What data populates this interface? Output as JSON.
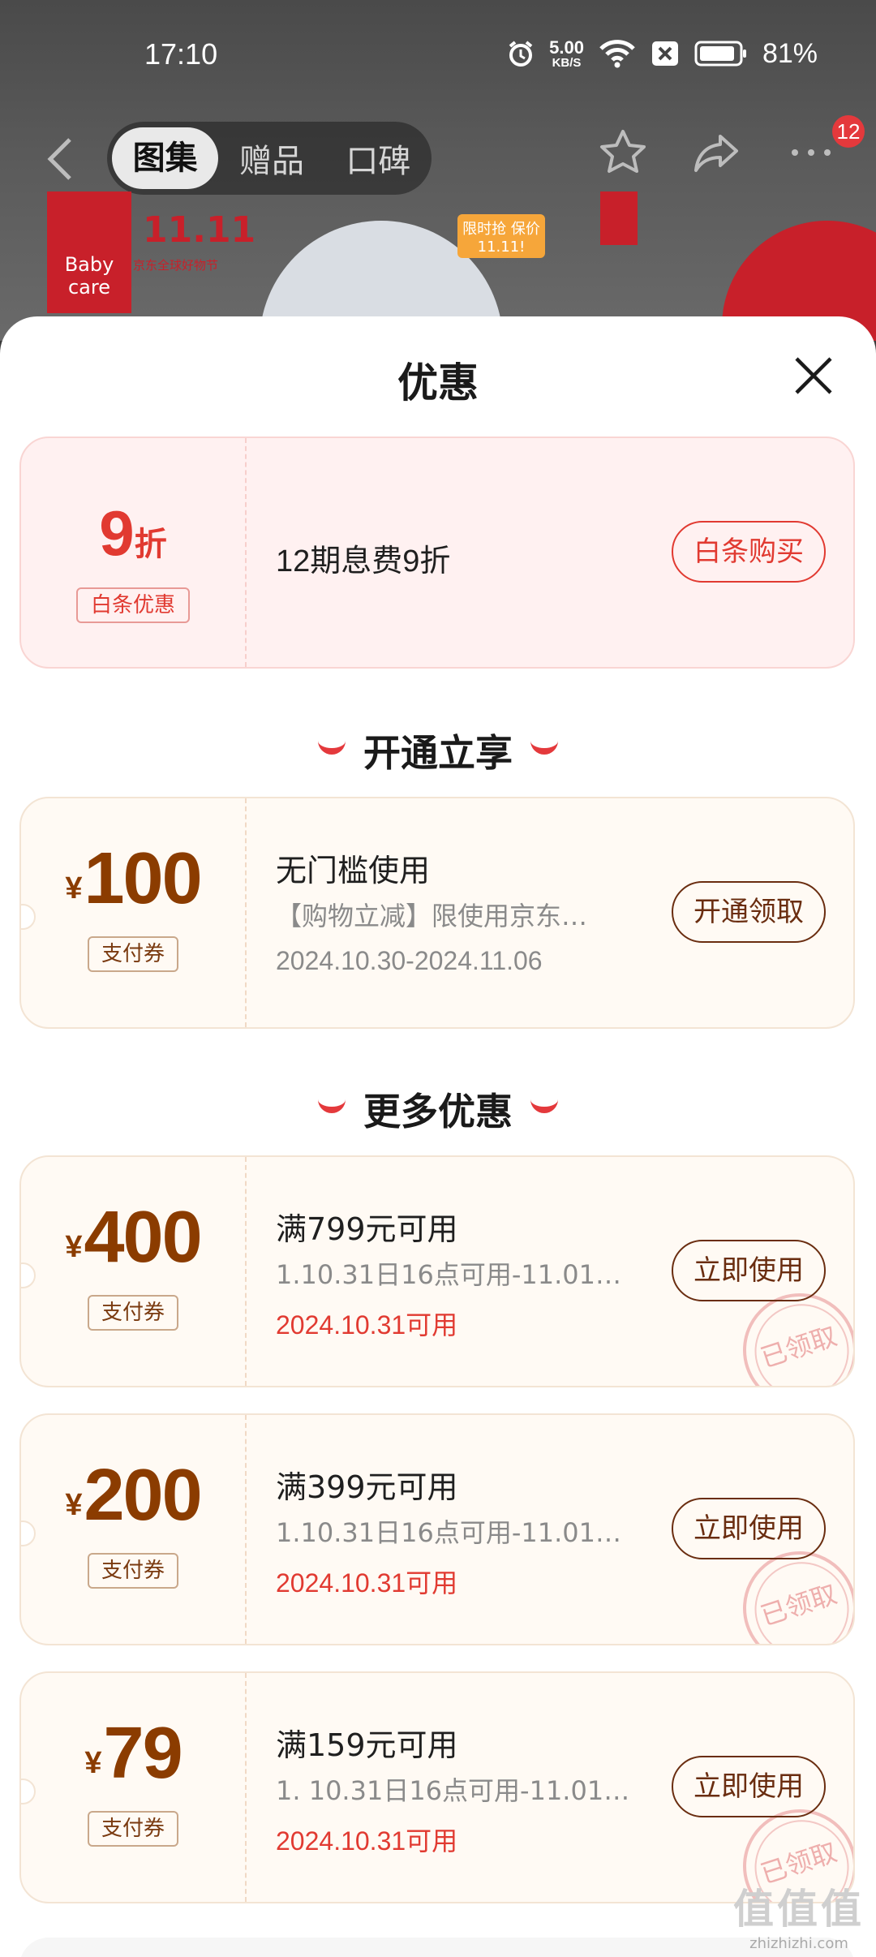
{
  "status_bar": {
    "time": "17:10",
    "speed_value": "5.00",
    "speed_unit": "KB/S",
    "battery": "81%"
  },
  "nav": {
    "tabs": [
      "图集",
      "赠品",
      "口碑"
    ],
    "active_tab": 0,
    "badge": "12"
  },
  "banner": {
    "logo": "Baby care",
    "promo": "11.11",
    "promo_sub": "京东全球好物节",
    "flash": "限时抢 保价11.11!"
  },
  "sheet": {
    "title": "优惠"
  },
  "baitiao": {
    "value": "9",
    "unit": "折",
    "tag": "白条优惠",
    "title": "12期息费9折",
    "button": "白条购买"
  },
  "sections": {
    "open": "开通立享",
    "more": "更多优惠"
  },
  "open_coupon": {
    "currency": "¥",
    "amount": "100",
    "tag": "支付券",
    "title": "无门槛使用",
    "desc": "【购物立减】限使用京东…",
    "date": "2024.10.30-2024.11.06",
    "button": "开通领取"
  },
  "coupons": [
    {
      "currency": "¥",
      "amount": "400",
      "tag": "支付券",
      "title": "满799元可用",
      "desc": "1.10.31日16点可用-11.01…",
      "date": "2024.10.31可用",
      "button": "立即使用",
      "stamp": "已领取"
    },
    {
      "currency": "¥",
      "amount": "200",
      "tag": "支付券",
      "title": "满399元可用",
      "desc": "1.10.31日16点可用-11.01…",
      "date": "2024.10.31可用",
      "button": "立即使用",
      "stamp": "已领取"
    },
    {
      "currency": "¥",
      "amount": "79",
      "tag": "支付券",
      "title": "满159元可用",
      "desc": "1. 10.31日16点可用-11.01…",
      "date": "2024.10.31可用",
      "button": "立即使用",
      "stamp": "已领取"
    }
  ],
  "watermark": {
    "logo": "值值值",
    "site": "zhizhizhi.com"
  },
  "colors": {
    "accent_red": "#e13a31",
    "coupon_brown": "#8b3c00",
    "card_cream": "#fffaf4",
    "card_pink": "#fff1f1"
  }
}
